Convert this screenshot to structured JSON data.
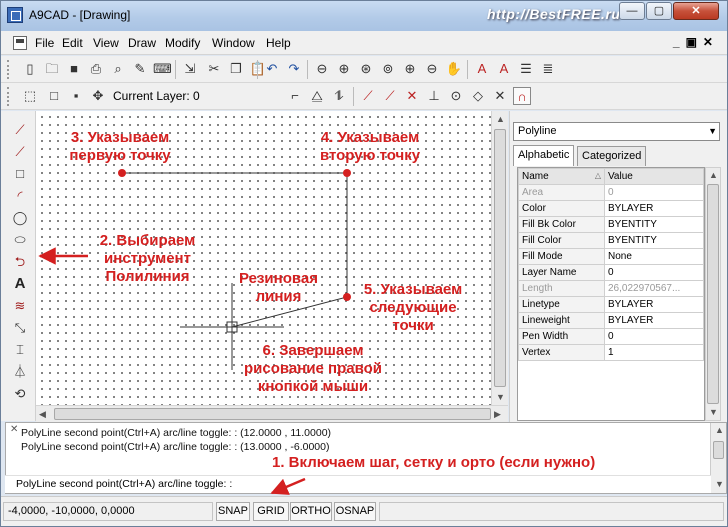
{
  "window": {
    "title": "A9CAD - [Drawing]",
    "watermark": "http://BestFREE.ru",
    "caption_buttons": {
      "minimize": "—",
      "maximize": "▢",
      "close": "✕"
    }
  },
  "menu": {
    "items": [
      "File",
      "Edit",
      "View",
      "Draw",
      "Modify",
      "Window",
      "Help"
    ],
    "mdi_buttons": "_▣✕"
  },
  "toolbar2": {
    "current_layer_label": "Current Layer: 0"
  },
  "drawing": {
    "annotation_color": "#d42020",
    "annotations": {
      "step3": "3. Указываем\nпервую точку",
      "step4": "4. Указываем\nвторую точку",
      "step2": "2. Выбираем\nинструмент\nПолилиния",
      "rubber": "Резиновая\nлиния",
      "step5": "5. Указываем\nследующие\nточки",
      "step6": "6. Завершаем\nрисование правой\nкнопкой мыши",
      "step1": "1. Включаем шаг, сетку и орто (если нужно)"
    }
  },
  "properties": {
    "selected_type": "Polyline",
    "tabs": [
      "Alphabetic",
      "Categorized"
    ],
    "columns": [
      "Name",
      "Value"
    ],
    "rows": [
      {
        "name": "Area",
        "value": "0",
        "disabled": true
      },
      {
        "name": "Color",
        "value": "BYLAYER",
        "disabled": false
      },
      {
        "name": "Fill Bk Color",
        "value": "BYENTITY",
        "disabled": false
      },
      {
        "name": "Fill Color",
        "value": "BYENTITY",
        "disabled": false
      },
      {
        "name": "Fill Mode",
        "value": "None",
        "disabled": false
      },
      {
        "name": "Layer Name",
        "value": "0",
        "disabled": false
      },
      {
        "name": "Length",
        "value": "26,022970567...",
        "disabled": true
      },
      {
        "name": "Linetype",
        "value": "BYLAYER",
        "disabled": false
      },
      {
        "name": "Lineweight",
        "value": "BYLAYER",
        "disabled": false
      },
      {
        "name": "Pen Width",
        "value": "0",
        "disabled": false
      },
      {
        "name": "Vertex",
        "value": "1",
        "disabled": false
      }
    ]
  },
  "command": {
    "history": [
      "PolyLine second point(Ctrl+A) arc/line toggle: : (12.0000 , 11.0000)",
      "PolyLine second point(Ctrl+A) arc/line toggle: : (13.0000 , -6.0000)"
    ],
    "prompt": "PolyLine second point(Ctrl+A) arc/line toggle: :"
  },
  "status": {
    "coords": "-4,0000, -10,0000, 0,0000",
    "buttons": [
      "SNAP",
      "GRID",
      "ORTHO",
      "OSNAP"
    ]
  }
}
